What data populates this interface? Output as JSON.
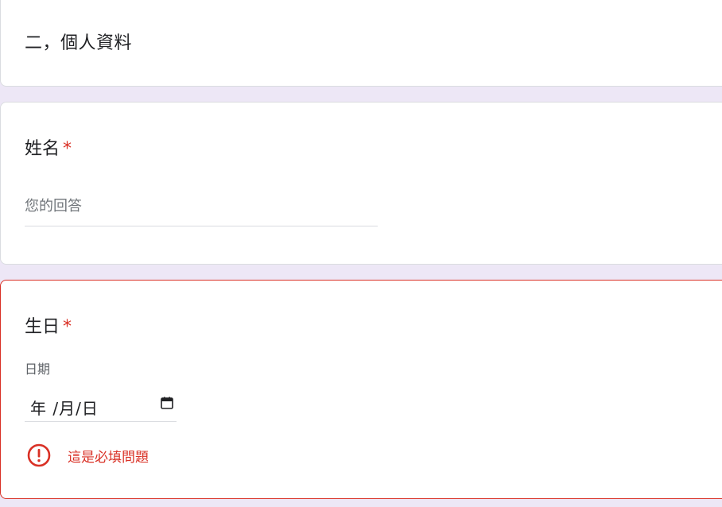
{
  "section": {
    "title": "二，個人資料"
  },
  "questions": [
    {
      "title": "姓名",
      "required_mark": "*",
      "placeholder": "您的回答"
    },
    {
      "title": "生日",
      "required_mark": "*",
      "date_label": "日期",
      "date_value": "年 /月/日",
      "error": "這是必填問題"
    }
  ],
  "colors": {
    "background": "#ede7f6",
    "error": "#d93025",
    "text": "#202124",
    "muted": "#5f6368"
  },
  "icons": {
    "calendar": "calendar-icon",
    "error": "error-icon"
  }
}
